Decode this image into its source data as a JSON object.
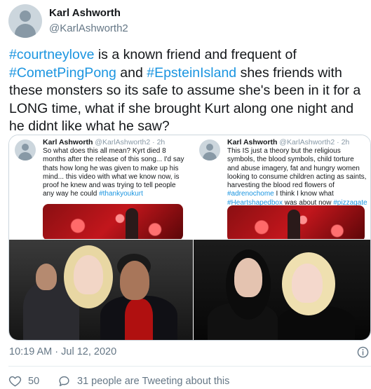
{
  "tweet": {
    "author_name": "Karl Ashworth",
    "author_handle": "@KarlAshworth2",
    "text_parts": [
      {
        "text": "#courtneylove",
        "hashtag": true
      },
      {
        "text": " is a known friend and frequent of ",
        "hashtag": false
      },
      {
        "text": "#CometPingPong",
        "hashtag": true
      },
      {
        "text": " and ",
        "hashtag": false
      },
      {
        "text": "#EpsteinIsland",
        "hashtag": true
      },
      {
        "text": " shes friends with these monsters so its safe to assume she's been in it for a LONG time, what if she brought Kurt along one night and he didnt like what he saw?",
        "hashtag": false
      }
    ],
    "timestamp": "10:19 AM · Jul 12, 2020",
    "likes": "50",
    "talk_label": "31 people are Tweeting about this"
  },
  "quoted": [
    {
      "name": "Karl Ashworth",
      "handle_time": "@KarlAshworth2 · 2h",
      "text_parts": [
        {
          "text": "So what does this all mean? Kyrt died 8 months after the release of this song... I'd say thats how long he was given to make up his mind... this video with what we know now, is proof he knew and was trying to tell people any way he could ",
          "hashtag": false
        },
        {
          "text": "#thankyoukurt",
          "hashtag": true
        }
      ]
    },
    {
      "name": "Karl Ashworth",
      "handle_time": "@KarlAshworth2 · 2h",
      "text_parts": [
        {
          "text": "This IS just a theory but the religious symbols, the blood symbols, child torture and abuse imagery, fat and hungry women looking to consume children acting as saints, harvesting the blood red flowers of ",
          "hashtag": false
        },
        {
          "text": "#adrenochome",
          "hashtag": true
        },
        {
          "text": " I think I know what ",
          "hashtag": false
        },
        {
          "text": "#Heartshapedbox",
          "hashtag": true
        },
        {
          "text": " was about now ",
          "hashtag": false
        },
        {
          "text": "#pizzagate",
          "hashtag": true
        }
      ]
    }
  ],
  "colors": {
    "text": "#14171a",
    "secondary": "#657786",
    "hashtag": "#1b95e0",
    "border": "#e6ecf0"
  },
  "icons": {
    "like": "heart-outline-icon",
    "talk": "speech-bubble-icon",
    "info": "info-circle-icon",
    "avatar": "default-avatar-icon"
  }
}
